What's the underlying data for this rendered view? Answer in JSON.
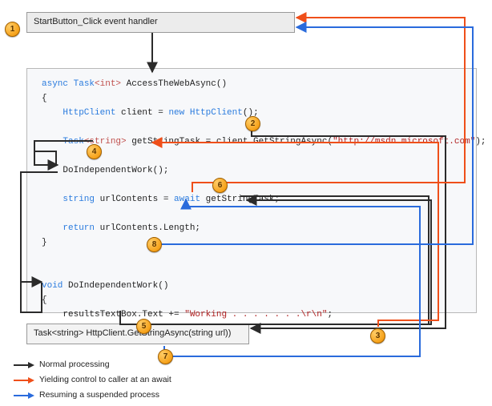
{
  "header_box": {
    "title": "StartButton_Click event handler"
  },
  "bottom_box": {
    "title": "Task<string> HttpClient.GetStringAsync(string url))"
  },
  "code": {
    "l1_async": "async",
    "l1_task": " Task",
    "l1_tparam": "<int>",
    "l1_rest": " AccessTheWebAsync()",
    "l2": "{",
    "l3_type": "    HttpClient",
    "l3_mid": " client = ",
    "l3_new": "new",
    "l3_type2": " HttpClient",
    "l3_end": "();",
    "blank": "",
    "l4_task": "    Task",
    "l4_tparam": "<string>",
    "l4_mid": " getStringTask = client.GetStringAsync(",
    "l4_str": "\"http://msdn.microsoft.com\"",
    "l4_end": ");",
    "l5": "    DoIndependentWork();",
    "l6_a": "    string",
    "l6_b": " urlContents = ",
    "l6_await": "await",
    "l6_c": " getStringTask;",
    "l7_ret": "    return",
    "l7_rest": " urlContents.Length;",
    "l8": "}",
    "d1_void": "void",
    "d1_rest": " DoIndependentWork()",
    "d2": "{",
    "d3_a": "    resultsTextBox.Text += ",
    "d3_str": "\"Working . . . . . . .\\r\\n\"",
    "d3_end": ";",
    "d4": "}"
  },
  "steps": {
    "1": "1",
    "2": "2",
    "3": "3",
    "4": "4",
    "5": "5",
    "6": "6",
    "7": "7",
    "8": "8"
  },
  "legend": {
    "normal": "Normal processing",
    "yield": "Yielding control to caller at an await",
    "resume": "Resuming a suspended process"
  },
  "colors": {
    "normal": "#2b2b2b",
    "yield": "#ef4f1a",
    "resume": "#2a6bdc"
  }
}
